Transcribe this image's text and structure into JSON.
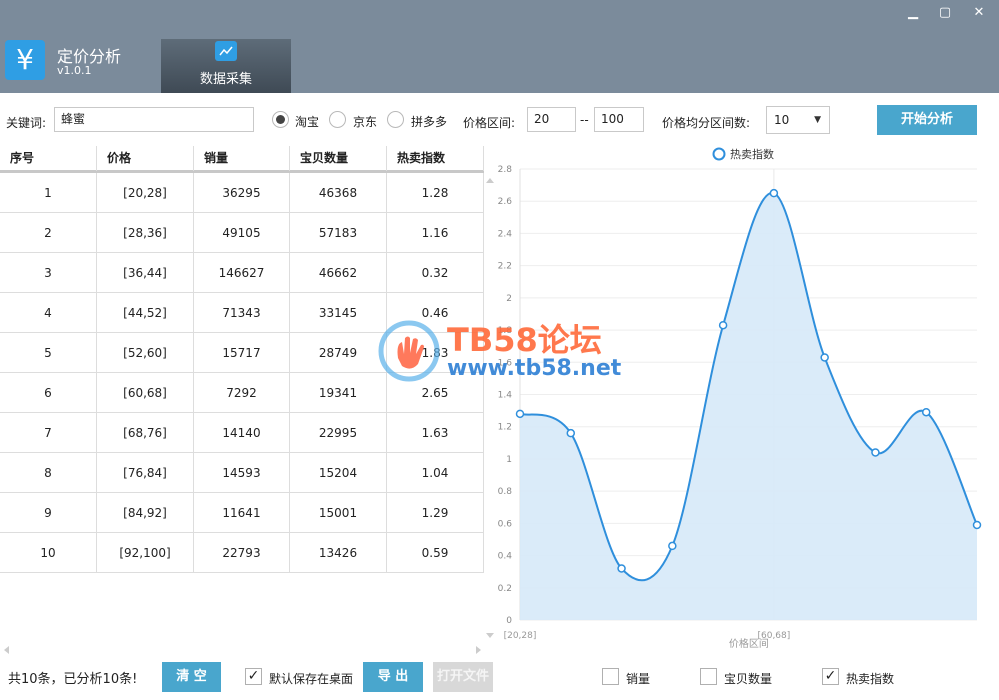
{
  "app": {
    "logo_glyph": "¥",
    "title": "定价分析",
    "version": "v1.0.1"
  },
  "tabs": [
    {
      "label": "数据采集"
    }
  ],
  "window": {
    "minimize": "▁",
    "maximize": "▢",
    "close": "✕"
  },
  "filters": {
    "keyword_label": "关键词:",
    "keyword_value": "蜂蜜",
    "platforms": [
      {
        "label": "淘宝",
        "selected": true
      },
      {
        "label": "京东",
        "selected": false
      },
      {
        "label": "拼多多",
        "selected": false
      }
    ],
    "price_range_label": "价格区间:",
    "price_min": "20",
    "price_sep": "--",
    "price_max": "100",
    "intervals_label": "价格均分区间数:",
    "intervals_value": "10",
    "start_button": "开始分析"
  },
  "table": {
    "columns": [
      "序号",
      "价格",
      "销量",
      "宝贝数量",
      "热卖指数"
    ],
    "rows": [
      [
        "1",
        "[20,28]",
        "36295",
        "46368",
        "1.28"
      ],
      [
        "2",
        "[28,36]",
        "49105",
        "57183",
        "1.16"
      ],
      [
        "3",
        "[36,44]",
        "146627",
        "46662",
        "0.32"
      ],
      [
        "4",
        "[44,52]",
        "71343",
        "33145",
        "0.46"
      ],
      [
        "5",
        "[52,60]",
        "15717",
        "28749",
        "1.83"
      ],
      [
        "6",
        "[60,68]",
        "7292",
        "19341",
        "2.65"
      ],
      [
        "7",
        "[68,76]",
        "14140",
        "22995",
        "1.63"
      ],
      [
        "8",
        "[76,84]",
        "14593",
        "15204",
        "1.04"
      ],
      [
        "9",
        "[84,92]",
        "11641",
        "15001",
        "1.29"
      ],
      [
        "10",
        "[92,100]",
        "22793",
        "13426",
        "0.59"
      ]
    ]
  },
  "footer": {
    "status": "共10条，已分析10条!",
    "clear_button": "清 空",
    "save_desktop_label": "默认保存在桌面",
    "save_desktop_checked": true,
    "export_button": "导 出",
    "open_file_button": "打开文件",
    "series_toggles": [
      {
        "label": "销量",
        "checked": false
      },
      {
        "label": "宝贝数量",
        "checked": false
      },
      {
        "label": "热卖指数",
        "checked": true
      }
    ]
  },
  "watermark": {
    "line1": "TB58论坛",
    "line2": "www.tb58.net"
  },
  "colors": {
    "titlebar": "#7b8b9b",
    "accent": "#2f9ee4",
    "button": "#49a6cd",
    "series": "#2f8fdc",
    "area": "#d6e9f8"
  },
  "chart_data": {
    "type": "area",
    "categories": [
      "[20,28]",
      "[28,36]",
      "[36,44]",
      "[44,52]",
      "[52,60]",
      "[60,68]",
      "[68,76]",
      "[76,84]",
      "[84,92]",
      "[92,100]"
    ],
    "series": [
      {
        "name": "热卖指数",
        "values": [
          1.28,
          1.16,
          0.32,
          0.46,
          1.83,
          2.65,
          1.63,
          1.04,
          1.29,
          0.59
        ]
      }
    ],
    "xlabel": "价格区间",
    "ylabel": "",
    "ylim": [
      0,
      2.8
    ],
    "yticks": [
      "0",
      "0.2",
      "0.4",
      "0.6",
      "0.8",
      "1",
      "1.2",
      "1.4",
      "1.6",
      "1.8",
      "2",
      "2.2",
      "2.4",
      "2.6",
      "2.8"
    ],
    "xtick_labels_shown": [
      "[20,28]",
      "[60,68]"
    ],
    "legend_position": "top",
    "grid": true,
    "smooth": true
  }
}
